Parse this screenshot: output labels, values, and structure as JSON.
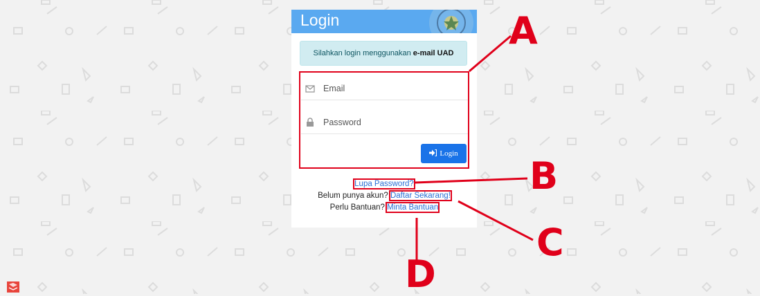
{
  "login": {
    "title": "Login",
    "info_text": "Silahkan login menggunakan",
    "info_bold": "e-mail UAD",
    "email_placeholder": "Email",
    "password_placeholder": "Password",
    "submit_label": "Login"
  },
  "links": {
    "forgot": "Lupa Password?",
    "no_account": "Belum punya akun?",
    "register": "Daftar Sekarang!",
    "need_help": "Perlu Bantuan?",
    "help": "Minta Bantuan"
  },
  "annotations": {
    "a": "A",
    "b": "B",
    "c": "C",
    "d": "D"
  },
  "colors": {
    "header": "#5aa9f0",
    "button": "#1a73e8",
    "annotation": "#e0001a",
    "info": "#d1ecf1"
  },
  "icons": [
    "envelope-icon",
    "lock-icon",
    "sign-in-icon",
    "university-logo"
  ]
}
